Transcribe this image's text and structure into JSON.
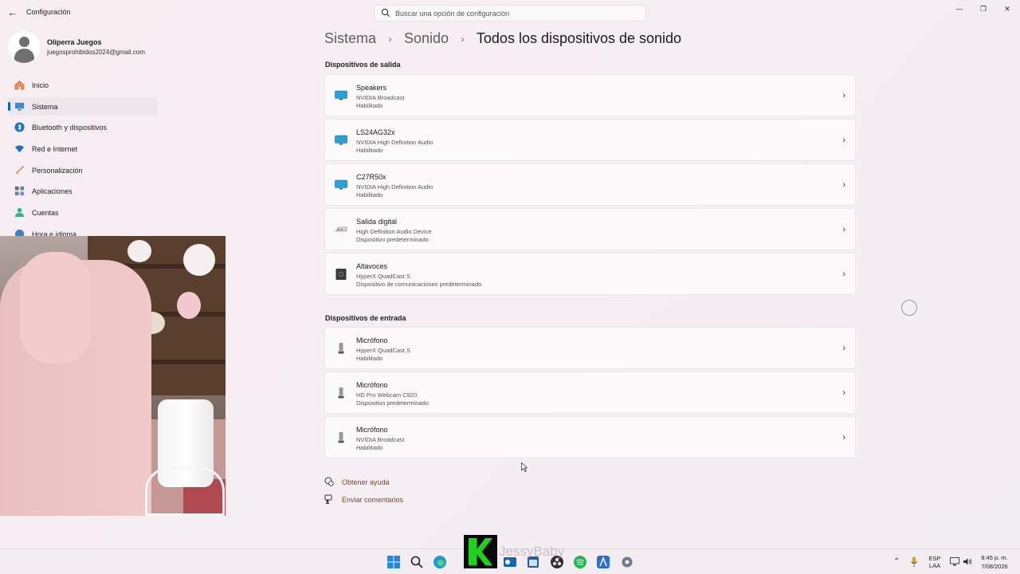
{
  "window": {
    "title": "Configuración",
    "back_icon": "arrow-left-icon",
    "controls": [
      "minimize",
      "maximize",
      "close"
    ]
  },
  "search": {
    "placeholder": "Buscar una opción de configuración"
  },
  "user": {
    "name": "Oliperra Juegos",
    "email": "juegosprohibidos2024@gmail.com"
  },
  "sidebar": {
    "items": [
      {
        "label": "Inicio",
        "icon": "home-icon",
        "active": false
      },
      {
        "label": "Sistema",
        "icon": "monitor-icon",
        "active": true
      },
      {
        "label": "Bluetooth y dispositivos",
        "icon": "bluetooth-icon",
        "active": false
      },
      {
        "label": "Red e Internet",
        "icon": "wifi-icon",
        "active": false
      },
      {
        "label": "Personalización",
        "icon": "brush-icon",
        "active": false
      },
      {
        "label": "Aplicaciones",
        "icon": "apps-icon",
        "active": false
      },
      {
        "label": "Cuentas",
        "icon": "account-icon",
        "active": false
      },
      {
        "label": "Hora e idioma",
        "icon": "clock-icon",
        "active": false
      }
    ]
  },
  "breadcrumb": {
    "items": [
      "Sistema",
      "Sonido",
      "Todos los dispositivos de sonido"
    ],
    "separator": "›"
  },
  "output_section": {
    "title": "Dispositivos de salida",
    "devices": [
      {
        "name": "Speakers",
        "subtitle": "NVIDIA Broadcast",
        "status": "Habilitado",
        "icon": "monitor-speaker-icon"
      },
      {
        "name": "LS24AG32x",
        "subtitle": "NVIDIA High Definition Audio",
        "status": "Habilitado",
        "icon": "monitor-speaker-icon"
      },
      {
        "name": "C27R50x",
        "subtitle": "NVIDIA High Definition Audio",
        "status": "Habilitado",
        "icon": "monitor-speaker-icon"
      },
      {
        "name": "Salida digital",
        "subtitle": "High Definition Audio Device",
        "status": "Dispositivo predeterminado",
        "icon": "digital-output-icon"
      },
      {
        "name": "Altavoces",
        "subtitle": "HyperX QuadCast S",
        "status": "Dispositivo de comunicaciones predeterminado",
        "icon": "speaker-icon"
      }
    ]
  },
  "input_section": {
    "title": "Dispositivos de entrada",
    "devices": [
      {
        "name": "Micrófono",
        "subtitle": "HyperX QuadCast S",
        "status": "Habilitado",
        "icon": "microphone-icon"
      },
      {
        "name": "Micrófono",
        "subtitle": "HD Pro Webcam C920",
        "status": "Dispositivo predeterminado",
        "icon": "microphone-icon"
      },
      {
        "name": "Micrófono",
        "subtitle": "NVIDIA Broadcast",
        "status": "Habilitado",
        "icon": "microphone-icon"
      }
    ]
  },
  "help": {
    "get_help": "Obtener ayuda",
    "send_feedback": "Enviar comentarios"
  },
  "watermark": {
    "text": "JessyBaby"
  },
  "taskbar": {
    "icons": [
      "windows-start-icon",
      "search-icon",
      "edge-icon",
      "file-explorer-icon",
      "outlook-icon",
      "calendar-icon",
      "obs-icon",
      "spotify-icon",
      "app-icon",
      "settings-icon"
    ],
    "language": "ESP",
    "language_sub": "LAA",
    "time": "8:45 p. m.",
    "date": "7/08/2026"
  },
  "colors": {
    "accent": "#0067c0",
    "link": "#7a4a1a",
    "background": "#f5eef2"
  }
}
